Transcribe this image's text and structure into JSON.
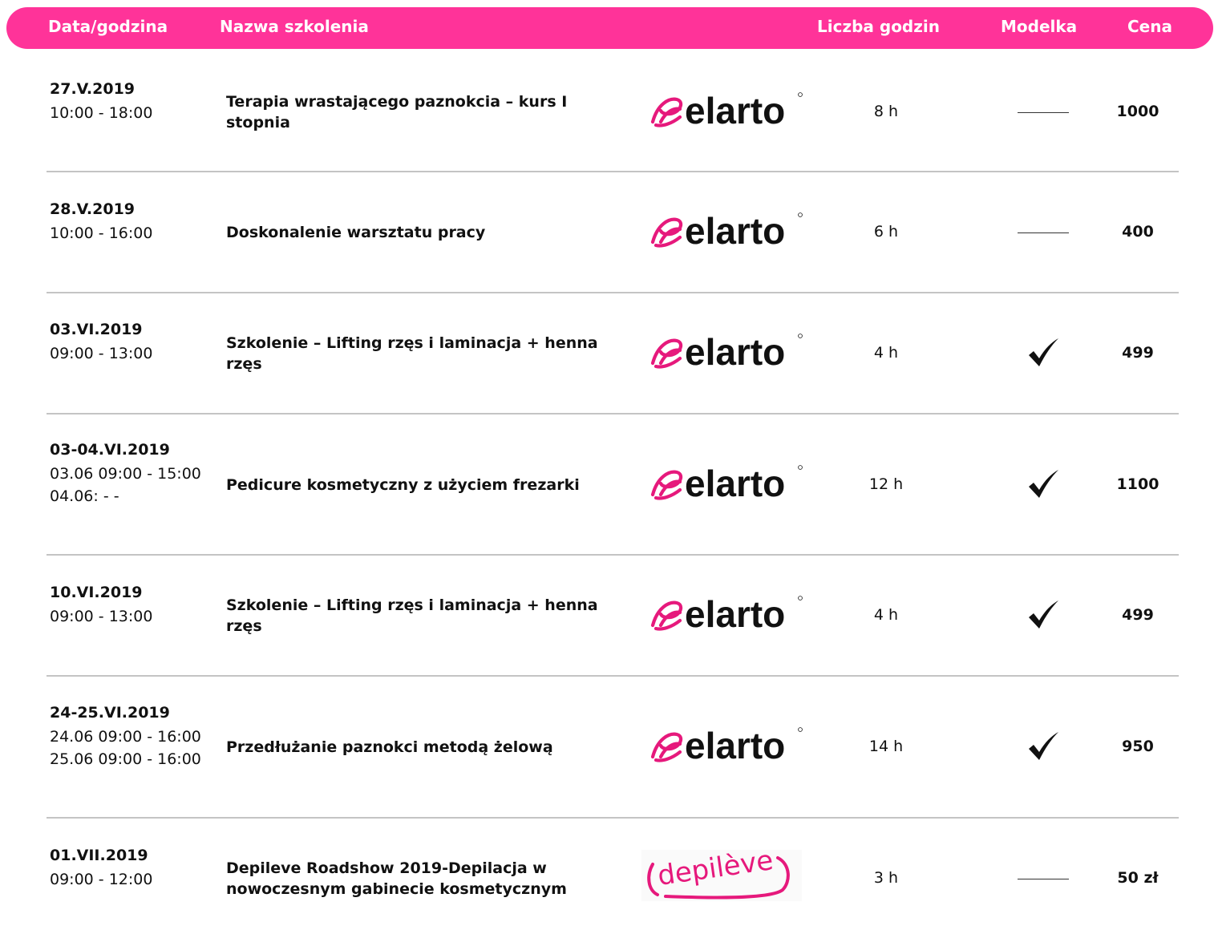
{
  "header": {
    "date": "Data/godzina",
    "name": "Nazwa szkolenia",
    "hours": "Liczba godzin",
    "model": "Modelka",
    "price": "Cena"
  },
  "colors": {
    "accent": "#ff3399",
    "divider": "#c4c4c4",
    "text": "#111111"
  },
  "rows": [
    {
      "date": "27.V.2019",
      "time": [
        "10:00 - 18:00"
      ],
      "name": "Terapia wrastającego paznokcia – kurs I stopnia",
      "logo": "elarto",
      "hours": "8 h",
      "model": false,
      "price": "1000"
    },
    {
      "date": "28.V.2019",
      "time": [
        "10:00 - 16:00"
      ],
      "name": "Doskonalenie warsztatu pracy",
      "logo": "elarto",
      "hours": "6 h",
      "model": false,
      "price": "400"
    },
    {
      "date": "03.VI.2019",
      "time": [
        "09:00 - 13:00"
      ],
      "name": "Szkolenie – Lifting rzęs i laminacja + henna rzęs",
      "logo": "elarto",
      "hours": "4 h",
      "model": true,
      "price": "499"
    },
    {
      "date": "03-04.VI.2019",
      "time": [
        "03.06  09:00 - 15:00",
        "04.06:  - -"
      ],
      "name": "Pedicure kosmetyczny z użyciem frezarki",
      "logo": "elarto",
      "hours": "12 h",
      "model": true,
      "price": "1100"
    },
    {
      "date": "10.VI.2019",
      "time": [
        "09:00 - 13:00"
      ],
      "name": "Szkolenie – Lifting rzęs i laminacja + henna rzęs",
      "logo": "elarto",
      "hours": "4 h",
      "model": true,
      "price": "499"
    },
    {
      "date": "24-25.VI.2019",
      "time": [
        "24.06  09:00 - 16:00",
        "25.06  09:00 - 16:00"
      ],
      "name": "Przedłużanie paznokci metodą żelową",
      "logo": "elarto",
      "hours": "14 h",
      "model": true,
      "price": "950"
    },
    {
      "date": "01.VII.2019",
      "time": [
        "09:00 - 12:00"
      ],
      "name": "Depileve Roadshow 2019-Depilacja w nowoczesnym gabinecie kosmetycznym",
      "logo": "depileve",
      "hours": "3 h",
      "model": false,
      "price": "50 zł"
    }
  ]
}
